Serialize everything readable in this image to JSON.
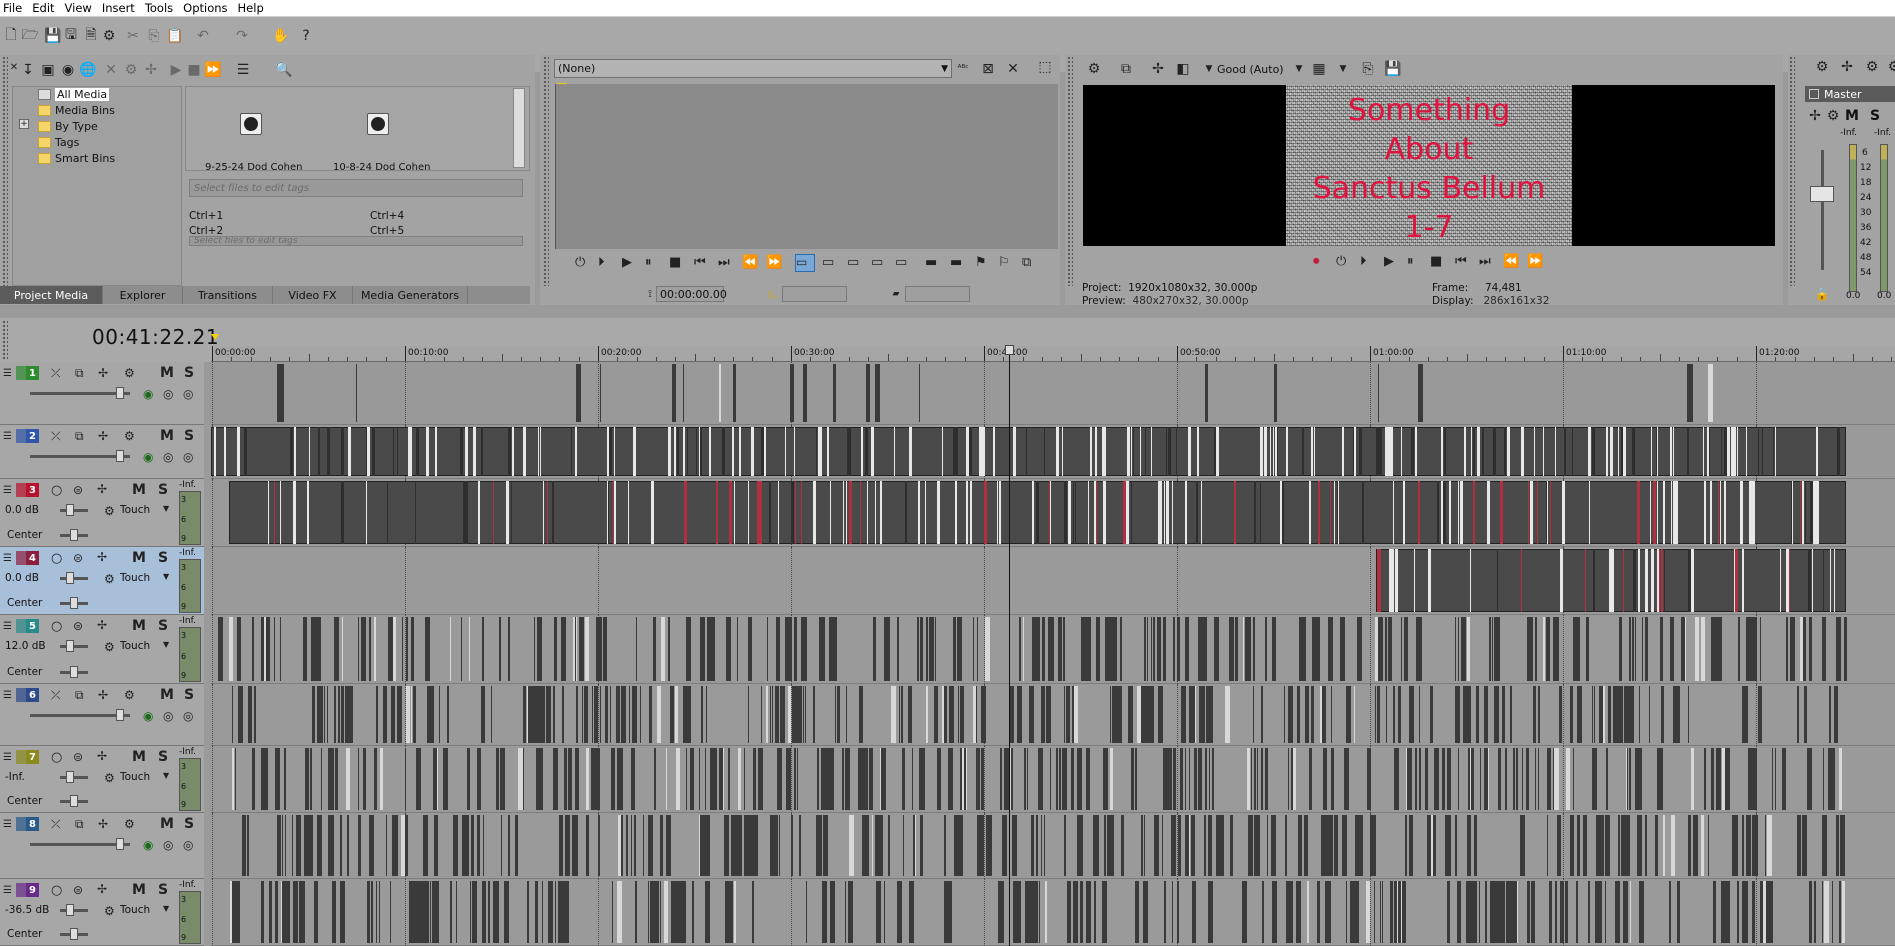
{
  "menu": [
    "File",
    "Edit",
    "View",
    "Insert",
    "Tools",
    "Options",
    "Help"
  ],
  "project_media": {
    "tree": [
      "All Media",
      "Media Bins",
      "By Type",
      "Tags",
      "Smart Bins"
    ],
    "thumbs": [
      "9-25-24 Dod Cohen",
      "10-8-24 Dod Cohen"
    ],
    "tag_placeholder": "Select files to edit tags",
    "shortcuts": [
      "Ctrl+1",
      "Ctrl+4",
      "Ctrl+2",
      "Ctrl+5"
    ],
    "tag_placeholder2": "Select files to edit tags",
    "tabs": [
      "Project Media",
      "Explorer",
      "Transitions",
      "Video FX",
      "Media Generators"
    ]
  },
  "trimmer": {
    "dropdown": "(None)",
    "timecode": "00:00:00.00"
  },
  "preview": {
    "quality": "Good (Auto)",
    "overlay_text": "Something\nAbout\nSanctus Bellum\n1-7",
    "project_label": "Project:",
    "project_value": "1920x1080x32, 30.000p",
    "preview_label": "Preview:",
    "preview_value": "480x270x32, 30.000p",
    "frame_label": "Frame:",
    "frame_value": "74,481",
    "display_label": "Display:",
    "display_value": "286x161x32"
  },
  "master": {
    "title": "Master",
    "m": "M",
    "s": "S",
    "inf_left": "-Inf.",
    "inf_right": "-Inf.",
    "scale": [
      "6",
      "12",
      "18",
      "24",
      "30",
      "36",
      "42",
      "48",
      "54"
    ],
    "bottom_left": "0.0",
    "bottom_right": "0.0"
  },
  "timeline": {
    "timecode": "00:41:22.21",
    "ruler": [
      "00:00:00",
      "00:10:00",
      "00:20:00",
      "00:30:00",
      "00:40:00",
      "00:50:00",
      "01:00:00",
      "01:10:00",
      "01:20:00"
    ],
    "m": "M",
    "s": "S",
    "touch": "Touch",
    "meter_inf": "-Inf.",
    "meter_scale": [
      "3",
      "6",
      "9"
    ],
    "tracks": [
      {
        "num": "1",
        "type": "video",
        "color": "#2e8b2e"
      },
      {
        "num": "2",
        "type": "video",
        "color": "#2f56a8"
      },
      {
        "num": "3",
        "type": "audio",
        "color": "#b8122e",
        "vol": "0.0 dB",
        "pan": "Center"
      },
      {
        "num": "4",
        "type": "audio",
        "color": "#8a1f3e",
        "vol": "0.0 dB",
        "pan": "Center"
      },
      {
        "num": "5",
        "type": "audio",
        "color": "#2a8a8a",
        "vol": "12.0 dB",
        "pan": "Center"
      },
      {
        "num": "6",
        "type": "video",
        "color": "#2e4a8a"
      },
      {
        "num": "7",
        "type": "audio",
        "color": "#8a8a1f",
        "vol": "-Inf.",
        "pan": "Center"
      },
      {
        "num": "8",
        "type": "video",
        "color": "#2a5a8a"
      },
      {
        "num": "9",
        "type": "audio",
        "color": "#6a2a8a",
        "vol": "-36.5 dB",
        "pan": "Center"
      }
    ]
  }
}
